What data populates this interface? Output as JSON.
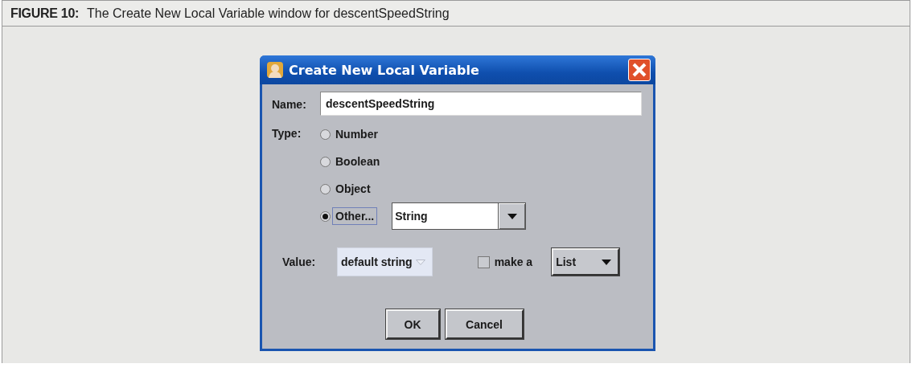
{
  "figure": {
    "label": "FIGURE 10:",
    "caption": "The Create New Local Variable window for descentSpeedString"
  },
  "window": {
    "title": "Create New Local Variable"
  },
  "name_field": {
    "label": "Name:",
    "value": "descentSpeedString"
  },
  "type": {
    "label": "Type:",
    "options": [
      {
        "label": "Number",
        "selected": false
      },
      {
        "label": "Boolean",
        "selected": false
      },
      {
        "label": "Object",
        "selected": false
      },
      {
        "label": "Other...",
        "selected": true
      }
    ]
  },
  "type_dropdown": {
    "value": "String"
  },
  "value": {
    "label": "Value:",
    "value": "default string"
  },
  "make_list": {
    "label": "make a",
    "checked": false,
    "dropdown": "List"
  },
  "buttons": [
    "OK",
    "Cancel"
  ]
}
